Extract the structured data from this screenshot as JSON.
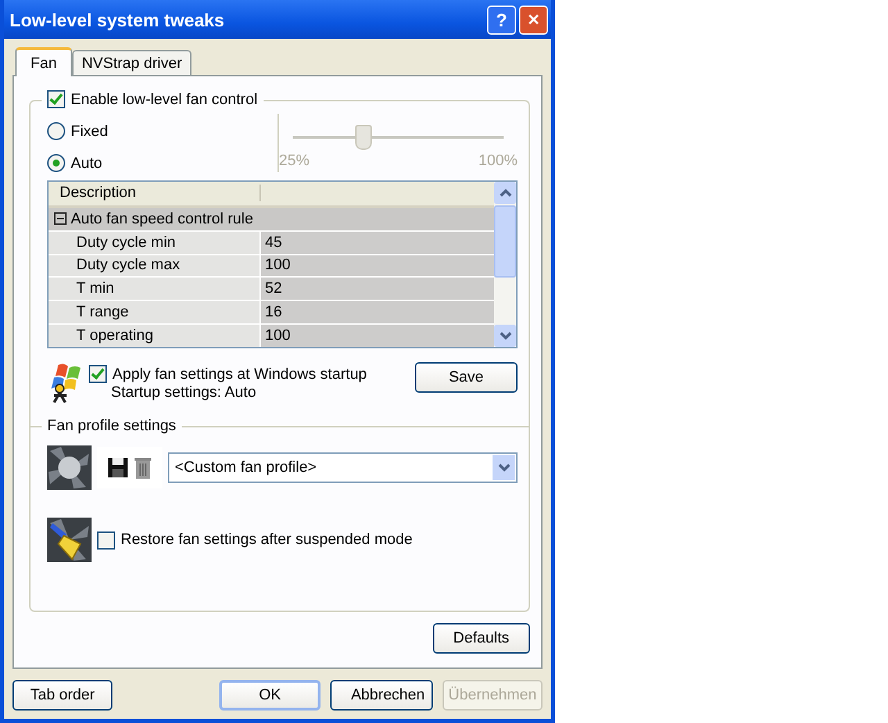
{
  "window": {
    "title": "Low-level system tweaks",
    "help_button": "?",
    "close_button": "✕"
  },
  "tabs": [
    {
      "label": "Fan",
      "selected": true
    },
    {
      "label": "NVStrap driver",
      "selected": false
    }
  ],
  "fan_control": {
    "label": "Enable low-level fan control",
    "checked": true
  },
  "modes": [
    {
      "label": "Fixed",
      "selected": false
    },
    {
      "label": "Auto",
      "selected": true
    }
  ],
  "slider": {
    "level": 0.33,
    "disabled": true,
    "min_label": "25%",
    "max_label": "100%"
  },
  "table": {
    "columns": [
      "Description"
    ],
    "group": {
      "label": "Auto fan speed control rule",
      "expanded": true
    },
    "rows": [
      {
        "name": "Duty cycle min",
        "value": "45"
      },
      {
        "name": "Duty cycle max",
        "value": "100"
      },
      {
        "name": "T min",
        "value": "52"
      },
      {
        "name": "T range",
        "value": "16"
      },
      {
        "name": "T operating",
        "value": "100"
      }
    ]
  },
  "startup": {
    "label": "Apply fan settings at Windows startup",
    "checked": true,
    "note": "Startup settings:  Auto",
    "save_button": "Save"
  },
  "profile": {
    "title": "Fan profile settings",
    "selection": "<Custom fan profile>"
  },
  "restore": {
    "label": "Restore fan settings after suspended mode",
    "checked": false
  },
  "defaults_button": "Defaults",
  "buttons": [
    {
      "label": "Tab order",
      "disabled": false
    },
    {
      "label": "OK",
      "disabled": false
    },
    {
      "label": "Abbrechen",
      "disabled": false
    },
    {
      "label": "Übernehmen",
      "disabled": true
    }
  ]
}
